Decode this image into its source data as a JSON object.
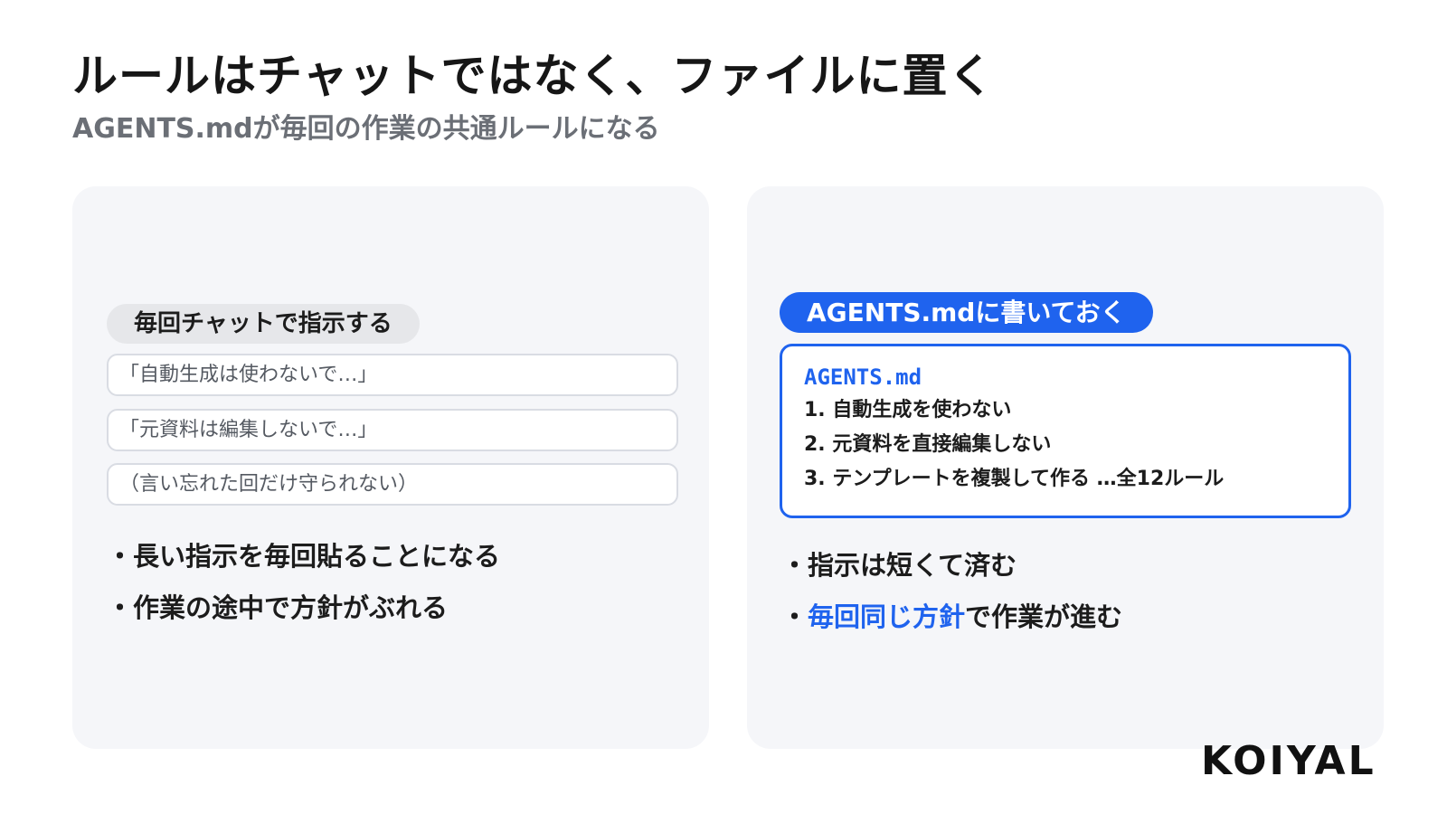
{
  "slide": {
    "title": "ルールはチャットではなく、ファイルに置く",
    "subtitle": "AGENTS.mdが毎回の作業の共通ルールになる"
  },
  "left_panel": {
    "label": "毎回チャットで指示する",
    "quotes": [
      "「自動生成は使わないで…」",
      "「元資料は編集しないで…」",
      "（言い忘れた回だけ守られない）"
    ],
    "bullets": [
      "・長い指示を毎回貼ることになる",
      "・作業の途中で方針がぶれる"
    ]
  },
  "right_panel": {
    "label": "AGENTS.mdに書いておく",
    "file_card": {
      "filename": "AGENTS.md",
      "lines": [
        "1. 自動生成を使わない",
        "2. 元資料を直接編集しない",
        "3. テンプレートを複製して作る …全12ルール"
      ]
    },
    "bullets": [
      {
        "prefix": "・指示は短くて済む",
        "highlight": "",
        "suffix": ""
      },
      {
        "prefix": "・",
        "highlight": "毎回同じ方針",
        "suffix": "で作業が進む"
      }
    ]
  },
  "logo": "KOIYAL",
  "colors": {
    "accent": "#1f63ee",
    "panel_bg": "#f5f6f9",
    "subtitle": "#6b6f76"
  }
}
